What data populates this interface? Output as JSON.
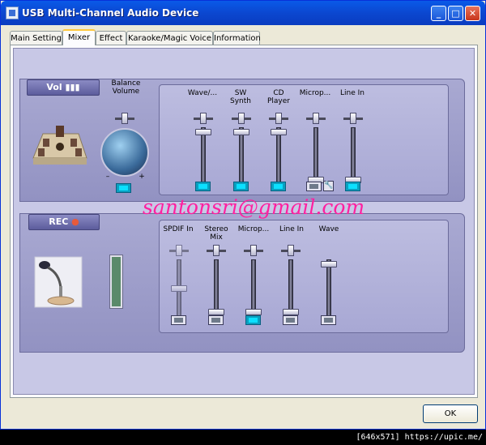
{
  "window": {
    "title": "USB Multi-Channel Audio Device",
    "minimize_icon": "minimize-icon",
    "maximize_icon": "maximize-icon",
    "close_icon": "close-icon"
  },
  "tabs": [
    {
      "label": "Main Setting"
    },
    {
      "label": "Mixer",
      "active": true
    },
    {
      "label": "Effect"
    },
    {
      "label": "Karaoke/Magic Voice"
    },
    {
      "label": "Information"
    }
  ],
  "playback": {
    "tag": "Vol",
    "balance_label": "Balance Volume",
    "channels": [
      {
        "label": "Wave/...",
        "level": 0.06,
        "muted": false
      },
      {
        "label": "SW Synth",
        "level": 0.06,
        "muted": false
      },
      {
        "label": "CD Player",
        "level": 0.06,
        "muted": false
      },
      {
        "label": "Microp...",
        "level": 0.92,
        "muted": true
      },
      {
        "label": "Line In",
        "level": 0.92,
        "muted": false
      }
    ]
  },
  "record": {
    "tag": "REC",
    "channels": [
      {
        "label": "SPDIF In",
        "level": 0.5,
        "muted": true
      },
      {
        "label": "Stereo Mix",
        "level": 0.92,
        "muted": true
      },
      {
        "label": "Microp...",
        "level": 0.92,
        "muted": false
      },
      {
        "label": "Line In",
        "level": 0.92,
        "muted": true
      },
      {
        "label": "Wave",
        "level": 0.06,
        "muted": true
      }
    ]
  },
  "watermark": "santonsri@gmail.com",
  "ok_label": "OK",
  "footer": "[646x571] https://upic.me/"
}
